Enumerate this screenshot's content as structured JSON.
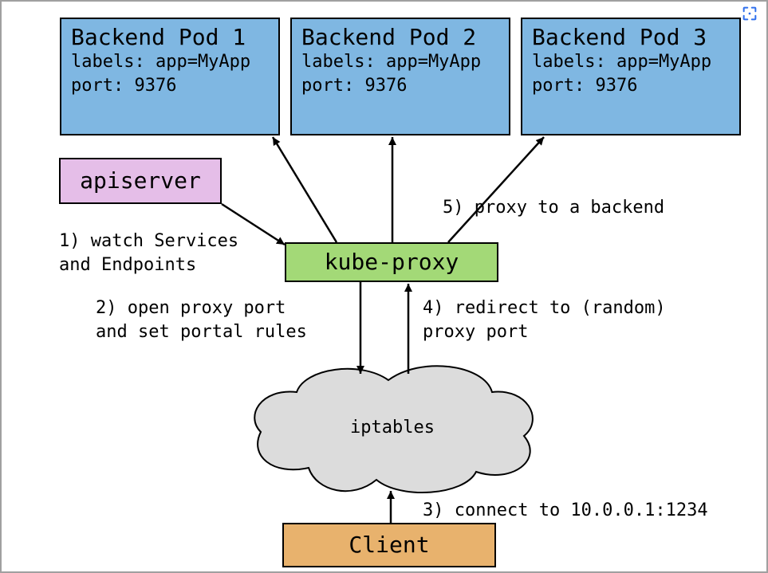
{
  "pods": [
    {
      "title": "Backend Pod 1",
      "labels": "labels: app=MyApp",
      "port": "port: 9376"
    },
    {
      "title": "Backend Pod 2",
      "labels": "labels: app=MyApp",
      "port": "port: 9376"
    },
    {
      "title": "Backend Pod 3",
      "labels": "labels: app=MyApp",
      "port": "port: 9376"
    }
  ],
  "apiserver": {
    "label": "apiserver"
  },
  "kubeproxy": {
    "label": "kube-proxy"
  },
  "iptables": {
    "label": "iptables"
  },
  "client": {
    "label": "Client"
  },
  "annotations": {
    "a1_line1": "1) watch Services",
    "a1_line2": "and Endpoints",
    "a2_line1": "2) open proxy port",
    "a2_line2": "and set portal rules",
    "a3": "3) connect to 10.0.0.1:1234",
    "a4_line1": "4) redirect to (random)",
    "a4_line2": "proxy port",
    "a5": "5) proxy to a backend"
  },
  "colors": {
    "pod": "#7fb7e2",
    "apiserver": "#e5bee8",
    "kubeproxy": "#a3d977",
    "client": "#e8b26d",
    "cloud_fill": "#dcdcdc",
    "accent": "#2f6fed"
  }
}
